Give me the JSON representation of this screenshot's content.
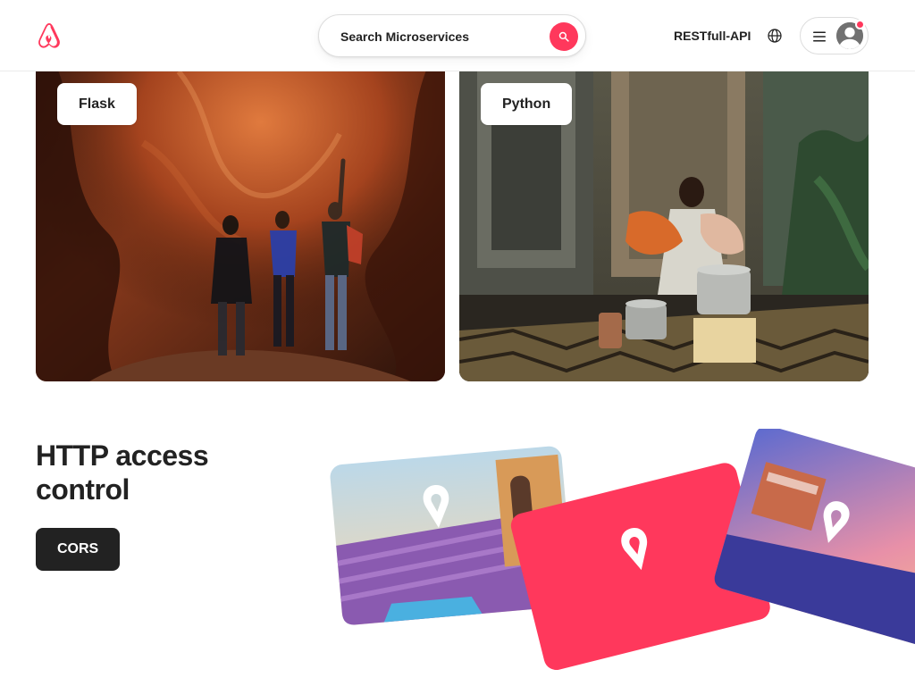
{
  "header": {
    "logo_icon": "airbnb-logo-icon",
    "search": {
      "placeholder": "Search Microservices"
    },
    "host_link_label": "RESTfull-API",
    "globe_icon": "globe-icon",
    "menu_icon": "hamburger-menu-icon",
    "avatar_icon": "user-avatar-icon"
  },
  "cards": [
    {
      "chip_label": "Flask"
    },
    {
      "chip_label": "Python"
    }
  ],
  "section": {
    "title": "HTTP access control",
    "button_label": "CORS"
  },
  "colors": {
    "brand": "#ff385c",
    "text": "#222222",
    "border": "#dddddd",
    "button_dark": "#222222"
  }
}
